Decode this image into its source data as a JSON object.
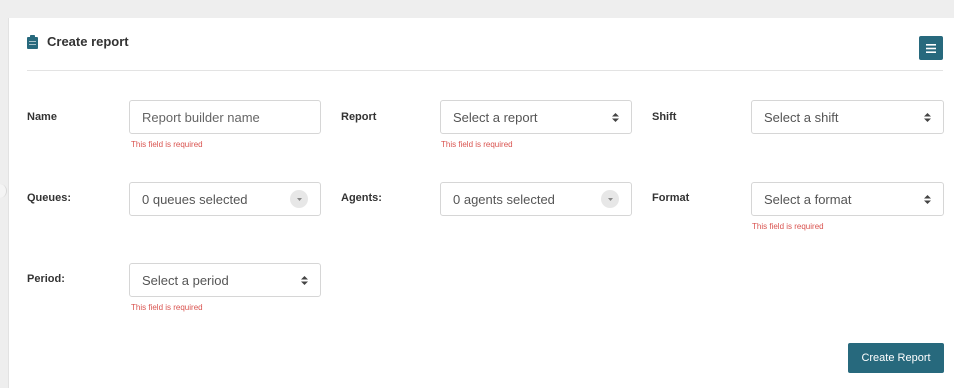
{
  "header": {
    "title": "Create report",
    "icon": "clipboard-icon",
    "menu_icon": "hamburger-menu-icon"
  },
  "colors": {
    "accent": "#27697d",
    "error": "#d9534f"
  },
  "form": {
    "name": {
      "label": "Name",
      "placeholder": "Report builder name",
      "error": "This field is required"
    },
    "report": {
      "label": "Report",
      "value": "Select a report",
      "error": "This field is required"
    },
    "shift": {
      "label": "Shift",
      "value": "Select a shift"
    },
    "queues": {
      "label": "Queues:",
      "value": "0 queues selected"
    },
    "agents": {
      "label": "Agents:",
      "value": "0 agents selected"
    },
    "format": {
      "label": "Format",
      "value": "Select a format",
      "error": "This field is required"
    },
    "period": {
      "label": "Period:",
      "value": "Select a period",
      "error": "This field is required"
    }
  },
  "actions": {
    "create_label": "Create Report"
  }
}
